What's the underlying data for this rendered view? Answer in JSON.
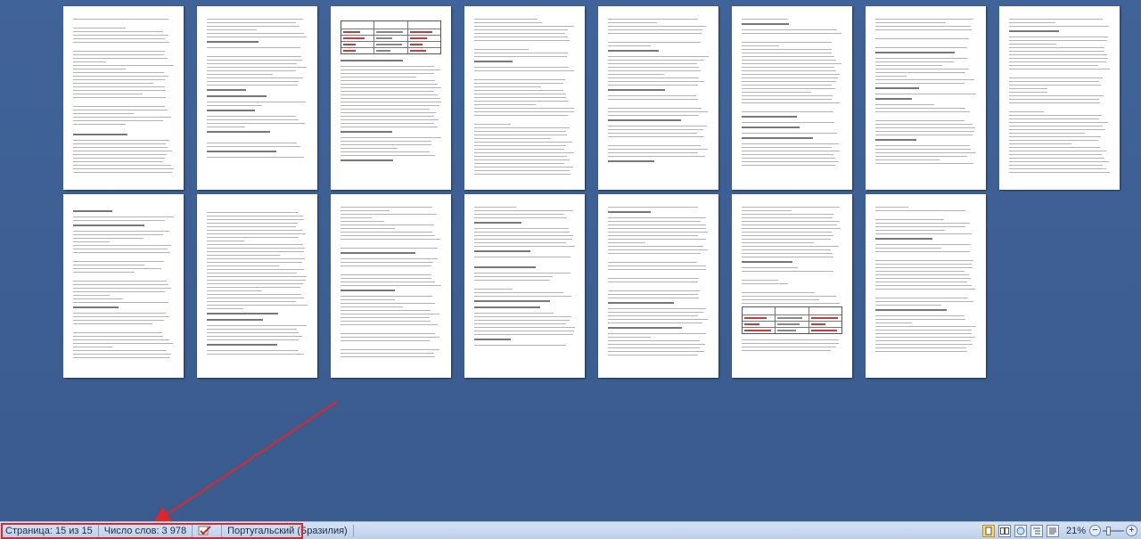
{
  "status_bar": {
    "page_label": "Страница: 15 из 15",
    "word_count_label": "Число слов: 3 978",
    "language": "Португальский (Бразилия)",
    "language_icon": "spellcheck-icon",
    "zoom": "21%",
    "zoom_out_symbol": "−",
    "zoom_in_symbol": "+"
  },
  "view_buttons": [
    "print-layout",
    "full-screen-reading",
    "web-layout",
    "outline",
    "draft"
  ],
  "annotation": {
    "color": "#e0242a"
  }
}
